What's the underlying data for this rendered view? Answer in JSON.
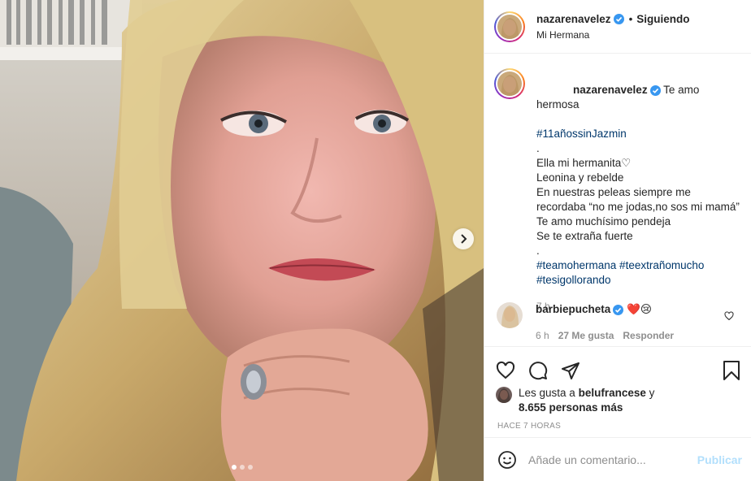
{
  "media": {
    "carousel": {
      "total_slides": 3,
      "active_slide": 1
    },
    "next_icon": "chevron-right-icon"
  },
  "header": {
    "username": "nazarenavelez",
    "verified_icon": "verified-badge-icon",
    "separator": "•",
    "following_label": "Siguiendo",
    "location": "Mi Hermana"
  },
  "caption": {
    "username": "nazarenavelez",
    "lines": [
      "Te amo hermosa",
      "#11añossinJazmin",
      ".",
      "Ella mi hermanita♡",
      "Leonina y rebelde",
      "En nuestras peleas siempre me recordaba “no me jodas,no sos mi mamá”",
      "Te amo muchísimo pendeja",
      "Se te extraña fuerte",
      ".",
      "#teamohermana #teextrañomucho #tesigollorando"
    ],
    "time": "7 h"
  },
  "comment": {
    "username": "barbiepucheta",
    "emojis": "❤️😢",
    "time": "6 h",
    "likes": "27 Me gusta",
    "reply_label": "Responder",
    "like_icon": "heart-outline-icon"
  },
  "actions": {
    "icons": [
      "heart-outline-icon",
      "comment-icon",
      "share-icon",
      "bookmark-icon"
    ]
  },
  "likes": {
    "prefix": "Les gusta a",
    "user": "belufrancese",
    "connector": "y",
    "others": "8.655 personas más"
  },
  "posted_ago": "HACE 7 HORAS",
  "add_comment": {
    "placeholder": "Añade un comentario...",
    "post_label": "Publicar",
    "emoji_icon": "smiley-icon"
  },
  "colors": {
    "link": "#00376b",
    "verified": "#3897f0",
    "muted": "#8e8e8e",
    "post_disabled": "#b2dffc",
    "heart_red": "#ed4956"
  }
}
